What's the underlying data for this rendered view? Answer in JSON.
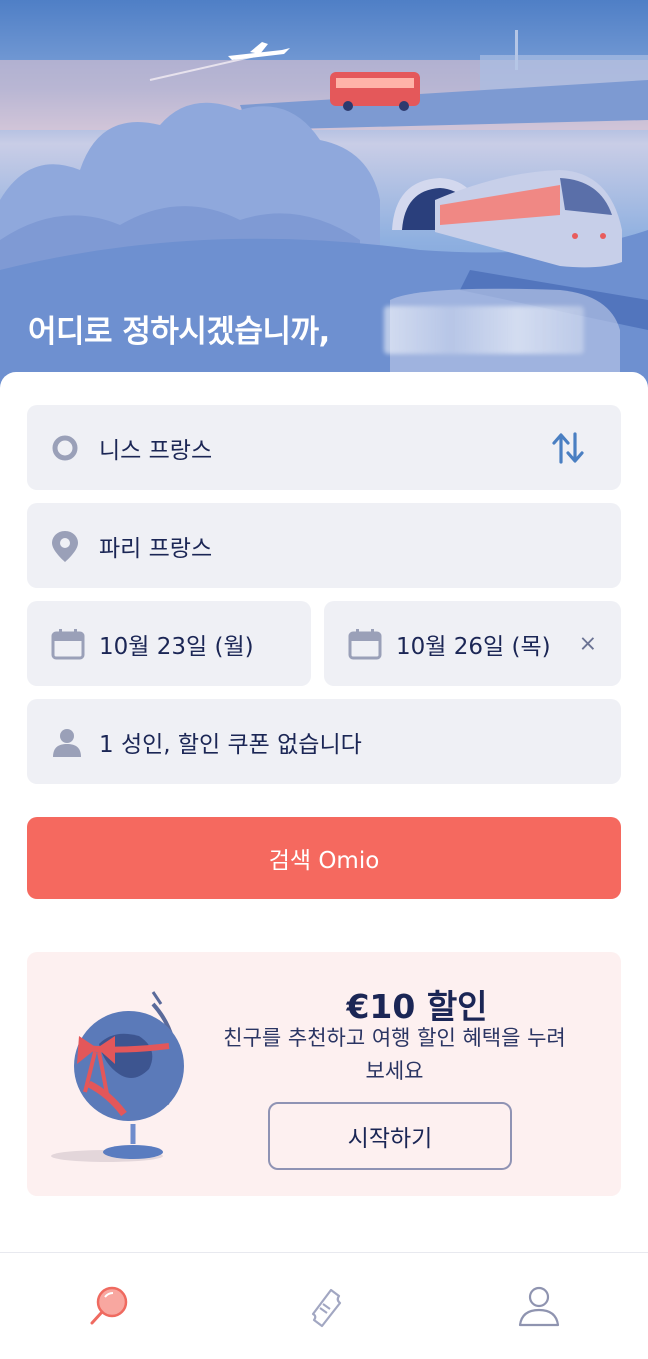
{
  "hero": {
    "greeting": "어디로 정하시겠습니까,"
  },
  "search": {
    "origin": {
      "value": "니스 프랑스",
      "icon": "origin-circle-icon"
    },
    "destination": {
      "value": "파리 프랑스",
      "icon": "location-pin-icon"
    },
    "departure": {
      "value": "10월 23일 (월)",
      "icon": "calendar-icon"
    },
    "return": {
      "value": "10월 26일 (목)",
      "icon": "calendar-icon",
      "clear": "×"
    },
    "passengers": {
      "value": "1 성인, 할인 쿠폰 없습니다",
      "icon": "person-icon"
    },
    "button_label": "검색  Omio"
  },
  "promo": {
    "title": "€10 할인",
    "text": "친구를 추천하고 여행 할인 혜택을 누려보세요",
    "button_label": "시작하기"
  },
  "nav": {
    "items": [
      {
        "name": "search",
        "icon": "search-icon",
        "active": true
      },
      {
        "name": "tickets",
        "icon": "ticket-icon",
        "active": false
      },
      {
        "name": "account",
        "icon": "account-icon",
        "active": false
      }
    ]
  },
  "colors": {
    "accent": "#f5695f",
    "field_bg": "#eff0f5",
    "promo_bg": "#fdf0f0",
    "text_dark": "#1b2655",
    "icon_gray": "#9aa0b8",
    "swap_blue": "#4a7fc2"
  }
}
